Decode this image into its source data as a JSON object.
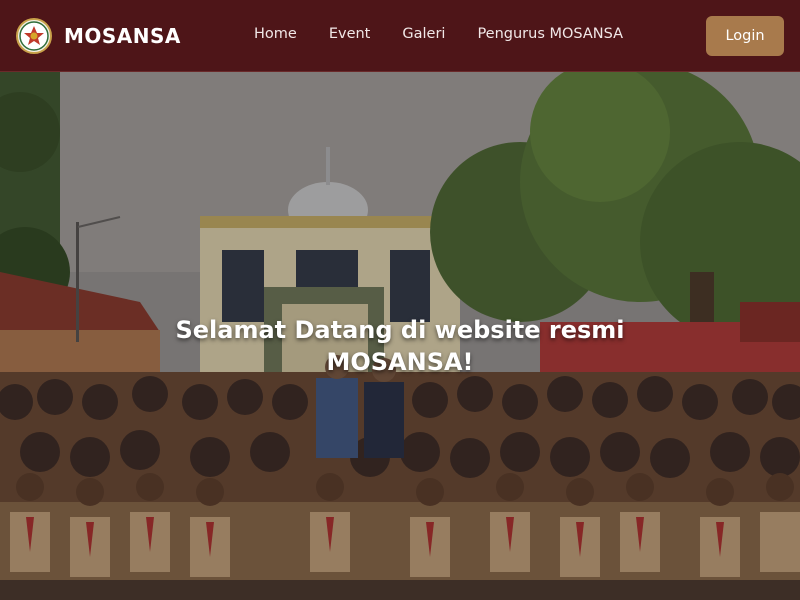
{
  "brand": {
    "name": "MOSANSA",
    "logo_icon": "scout-emblem-icon"
  },
  "nav": {
    "items": [
      {
        "label": "Home"
      },
      {
        "label": "Event"
      },
      {
        "label": "Galeri"
      },
      {
        "label": "Pengurus MOSANSA"
      }
    ],
    "login_label": "Login"
  },
  "hero": {
    "title": "Selamat Datang di website resmi MOSANSA!",
    "photo": "group-photo-of-scout-students-in-front-of-mosque"
  },
  "colors": {
    "navbar_bg": "#4e1518",
    "login_button_bg": "#a87a4c",
    "text_light": "#ffffff"
  }
}
